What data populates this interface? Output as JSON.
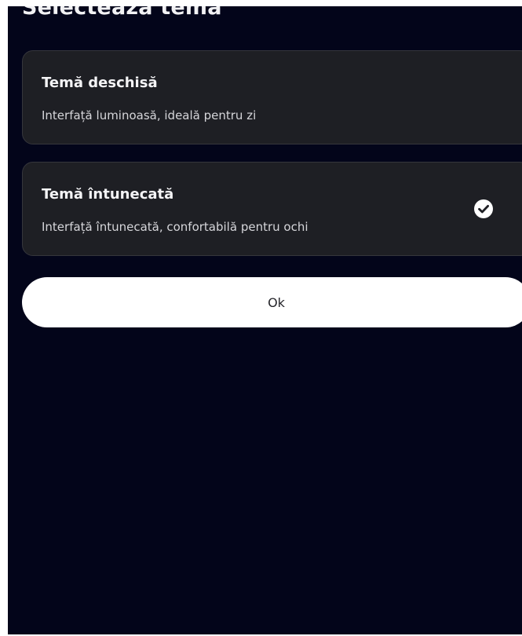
{
  "dialog": {
    "title": "Selectează tema"
  },
  "options": [
    {
      "title": "Temă deschisă",
      "description": "Interfață luminoasă, ideală pentru zi",
      "selected": false
    },
    {
      "title": "Temă întunecată",
      "description": "Interfață întunecată, confortabilă pentru ochi",
      "selected": true
    }
  ],
  "selected_icon": "checkmark-circle-icon",
  "actions": {
    "ok_label": "Ok"
  },
  "colors": {
    "background": "#03051a",
    "card": "#1e1f24",
    "button": "#ffffff"
  }
}
